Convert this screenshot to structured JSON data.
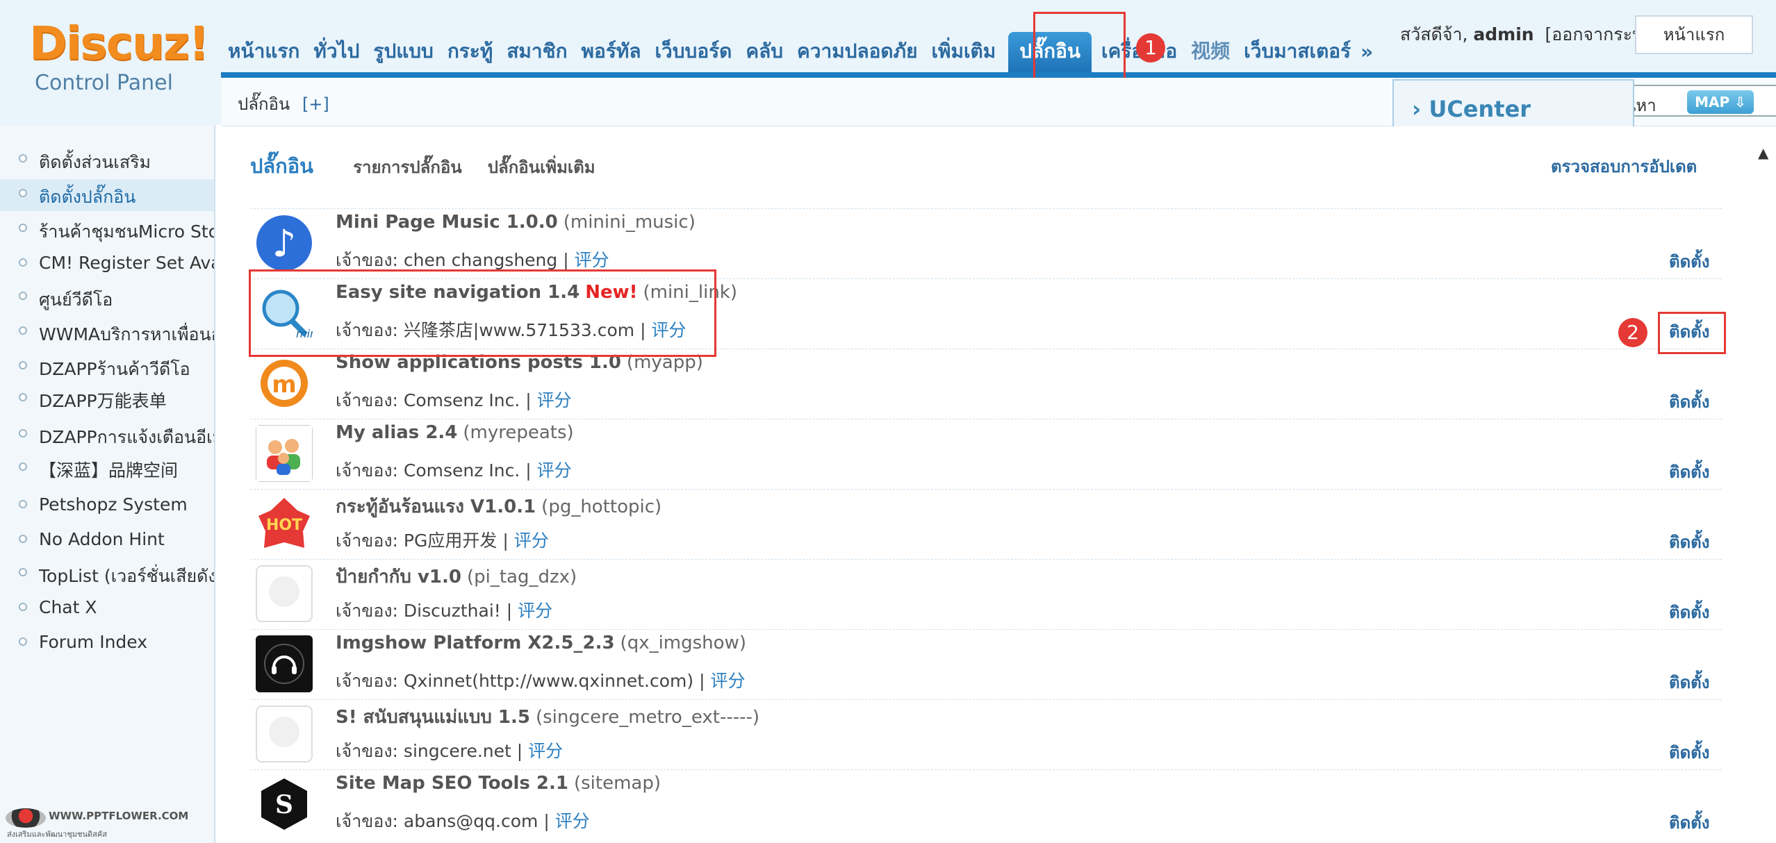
{
  "header": {
    "logo_primary": "Discuz!",
    "logo_secondary": "Control Panel",
    "nav": [
      {
        "label": "หน้าแรก"
      },
      {
        "label": "ทั่วไป"
      },
      {
        "label": "รูปแบบ"
      },
      {
        "label": "กระทู้"
      },
      {
        "label": "สมาชิก"
      },
      {
        "label": "พอร์ทัล"
      },
      {
        "label": "เว็บบอร์ด"
      },
      {
        "label": "คลับ"
      },
      {
        "label": "ความปลอดภัย"
      },
      {
        "label": "เพิ่มเติม"
      },
      {
        "label": "ปลั๊กอิน"
      },
      {
        "label": "เครื่องมือ"
      },
      {
        "label": "视频"
      },
      {
        "label": "เว็บมาสเตอร์"
      }
    ],
    "nav_more": "»",
    "greeting": "สวัสดีจ้า,",
    "username": "admin",
    "logout": "[ออกจากระบบ]",
    "home_button": "หน้าแรก",
    "markers": {
      "first": "1",
      "second": "2"
    }
  },
  "subbar": {
    "crumb": "ปลั๊กอิน",
    "crumb_add": "[+]",
    "search_button": "นหา",
    "map_button": "MAP"
  },
  "popup": {
    "ucenter": "› UCenter"
  },
  "sidebar": {
    "items": [
      {
        "label": "ติดตั้งส่วนเสริม"
      },
      {
        "label": "ติดตั้งปลั๊กอิน"
      },
      {
        "label": "ร้านค้าชุมชนMicro Store"
      },
      {
        "label": "CM! Register Set Avatar"
      },
      {
        "label": "ศูนย์วีดีโอ"
      },
      {
        "label": "WWMAบริการหาเพื่อนออนไลน์"
      },
      {
        "label": "DZAPPร้านค้าวีดีโอ"
      },
      {
        "label": "DZAPP万能表单"
      },
      {
        "label": "DZAPPการแจ้งเตือนอีเมล"
      },
      {
        "label": "【深蓝】品牌空间"
      },
      {
        "label": "Petshopz System"
      },
      {
        "label": "No Addon Hint"
      },
      {
        "label": "TopList (เวอร์ชั่นเสียดัง)"
      },
      {
        "label": "Chat X"
      },
      {
        "label": "Forum Index"
      }
    ],
    "footer_logo": "WWW.PPTFLOWER.COM",
    "footer_tagline": "ส่งเสริมและพัฒนาชุมชนดิสคัส"
  },
  "main": {
    "tab_main": "ปลั๊กอิน",
    "tabs": [
      "รายการปลั๊กอิน",
      "ปลั๊กอินเพิ่มเติม"
    ],
    "check_update": "ตรวจสอบการอัปเดต",
    "author_prefix": "เจ้าของ:",
    "rate_label": "评分",
    "install_label": "ติดตั้ง",
    "plugins": [
      {
        "name": "Mini Page Music 1.0.0",
        "id": "(minini_music)",
        "new": "",
        "author": "chen changsheng",
        "icon": "music-note-icon",
        "color": "#2d6fd8"
      },
      {
        "name": "Easy site navigation 1.4",
        "id": "(mini_link)",
        "new": "New!",
        "author": "兴隆茶店|www.571533.com",
        "icon": "globe-magnifier-icon",
        "color": "#4aa6de"
      },
      {
        "name": "Show applications posts 1.0",
        "id": "(myapp)",
        "new": "",
        "author": "Comsenz Inc.",
        "icon": "m-logo-icon",
        "color": "#f08a1c"
      },
      {
        "name": "My alias 2.4",
        "id": "(myrepeats)",
        "new": "",
        "author": "Comsenz Inc.",
        "icon": "users-icon",
        "color": "#4caf50"
      },
      {
        "name": "กระทู้อันร้อนแรง V1.0.1",
        "id": "(pg_hottopic)",
        "new": "",
        "author": "PG应用开发",
        "icon": "hot-badge-icon",
        "color": "#e53935"
      },
      {
        "name": "ป้ายกำกับ v1.0",
        "id": "(pi_tag_dzx)",
        "new": "",
        "author": "Discuzthai!",
        "icon": "blank-placeholder-icon",
        "color": "#eeeeee"
      },
      {
        "name": "Imgshow Platform X2.5_2.3",
        "id": "(qx_imgshow)",
        "new": "",
        "author": "Qxinnet(http://www.qxinnet.com)",
        "icon": "headphones-icon",
        "color": "#111111"
      },
      {
        "name": "S! สนับสนุนแม่แบบ 1.5",
        "id": "(singcere_metro_ext-----)",
        "new": "",
        "author": "singcere.net",
        "icon": "blank-placeholder-icon",
        "color": "#eeeeee"
      },
      {
        "name": "Site Map SEO Tools 2.1",
        "id": "(sitemap)",
        "new": "",
        "author": "abans@qq.com",
        "icon": "s-hexagon-icon",
        "color": "#111111"
      }
    ]
  }
}
